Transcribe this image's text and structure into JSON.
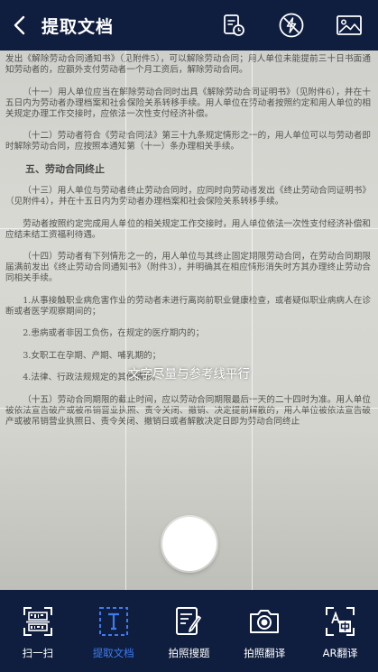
{
  "header": {
    "title": "提取文档",
    "icons": [
      "history-document-icon",
      "flash-off-icon",
      "gallery-icon"
    ]
  },
  "document": {
    "paragraphs": [
      {
        "style": "plain",
        "text": "发出《解除劳动合同通知书》（见附件5），可以解除劳动合同；用人单位未能提前三十日书面通知劳动者的，应额外支付劳动者一个月工资后，解除劳动合同。"
      },
      {
        "style": "indent",
        "text": "（十一）用人单位应当在解除劳动合同时出具《解除劳动合同证明书》（见附件6），并在十五日内为劳动者办理档案和社会保险关系转移手续。用人单位在劳动者按照约定和用人单位的相关规定办理工作交接时，应依法一次性支付经济补偿。"
      },
      {
        "style": "indent",
        "text": "（十二）劳动者符合《劳动合同法》第三十九条规定情形之一的，用人单位可以与劳动者即时解除劳动合同，应按照本通知第（十一）条办理相关手续。"
      },
      {
        "style": "heading",
        "text": "五、劳动合同终止"
      },
      {
        "style": "indent",
        "text": "（十三）用人单位与劳动者终止劳动合同时，应同时向劳动者发出《终止劳动合同证明书》（见附件4），并在十五日内为劳动者办理档案和社会保险关系转移手续。"
      },
      {
        "style": "indent",
        "text": "劳动者按照约定完成用人单位的相关规定工作交接时，用人单位依法一次性支付经济补偿和应结未结工资福利待遇。"
      },
      {
        "style": "indent",
        "text": "（十四）劳动者有下列情形之一的，用人单位与其终止固定期限劳动合同，在劳动合同期限届满前发出《终止劳动合同通知书》（附件3），并明确其在相应情形消失时方其办理终止劳动合同相关手续。"
      },
      {
        "style": "indent",
        "text": "1.从事接触职业病危害作业的劳动者未进行离岗前职业健康检查，或者疑似职业病病人在诊断或者医学观察期间的；"
      },
      {
        "style": "indent",
        "text": "2.患病或者非因工负伤，在规定的医疗期内的；"
      },
      {
        "style": "indent",
        "text": "3.女职工在孕期、产期、哺乳期的；"
      },
      {
        "style": "indent",
        "text": "4.法律、行政法规规定的其他情形。"
      },
      {
        "style": "indent",
        "text": "（十五）劳动合同期限的截止时间，应以劳动合同期限最后一天的二十四时为准。用人单位被依法宣告破产或被吊销营业执照、责令关闭、撤销、决定提前解散的，用人单位被依法宣告破产或被吊销营业执照日、责令关闭、撤销日或者解散决定日即为劳动合同终止"
      }
    ]
  },
  "viewfinder": {
    "hint": "文字尽量与参考线平行",
    "shutter_icon": "shutter-button-icon"
  },
  "tabs": [
    {
      "label": "扫一扫",
      "icon": "scan-icon",
      "active": false
    },
    {
      "label": "提取文档",
      "icon": "extract-text-icon",
      "active": true
    },
    {
      "label": "拍照搜题",
      "icon": "photo-question-icon",
      "active": false
    },
    {
      "label": "拍照翻译",
      "icon": "camera-translate-icon",
      "active": false
    },
    {
      "label": "AR翻译",
      "icon": "ar-translate-icon",
      "active": false
    }
  ],
  "colors": {
    "bar_bg": "#0f1e3e",
    "accent": "#3d7cf0",
    "text": "#ffffff"
  }
}
